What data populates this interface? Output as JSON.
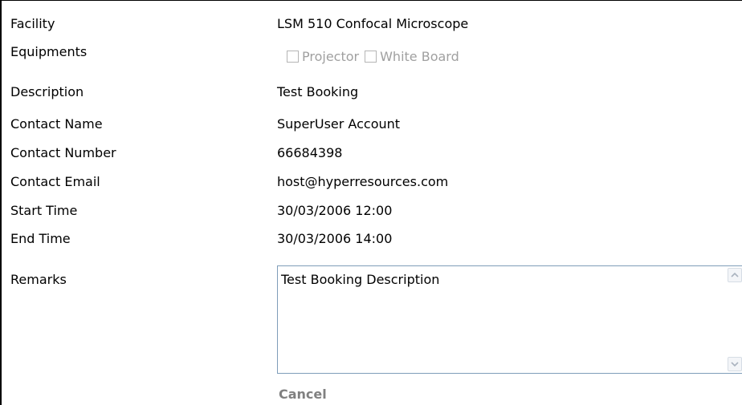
{
  "form": {
    "facility": {
      "label": "Facility",
      "value": "LSM 510 Confocal Microscope"
    },
    "equipments": {
      "label": "Equipments",
      "options": [
        {
          "label": "Projector",
          "checked": false
        },
        {
          "label": "White Board",
          "checked": false
        }
      ]
    },
    "description": {
      "label": "Description",
      "value": "Test Booking"
    },
    "contact_name": {
      "label": "Contact Name",
      "value": "SuperUser Account"
    },
    "contact_number": {
      "label": "Contact Number",
      "value": "66684398"
    },
    "contact_email": {
      "label": "Contact Email",
      "value": "host@hyperresources.com"
    },
    "start_time": {
      "label": "Start Time",
      "value": "30/03/2006 12:00"
    },
    "end_time": {
      "label": "End Time",
      "value": "30/03/2006 14:00"
    },
    "remarks": {
      "label": "Remarks",
      "value": "Test Booking Description"
    }
  },
  "actions": {
    "cancel_label": "Cancel"
  },
  "colors": {
    "disabled_text": "#a0a0a0",
    "textarea_border": "#7f9db9",
    "cancel_text": "#808080"
  },
  "icons": {
    "scroll_up": "scroll-up-arrow-icon",
    "scroll_down": "scroll-down-arrow-icon"
  }
}
